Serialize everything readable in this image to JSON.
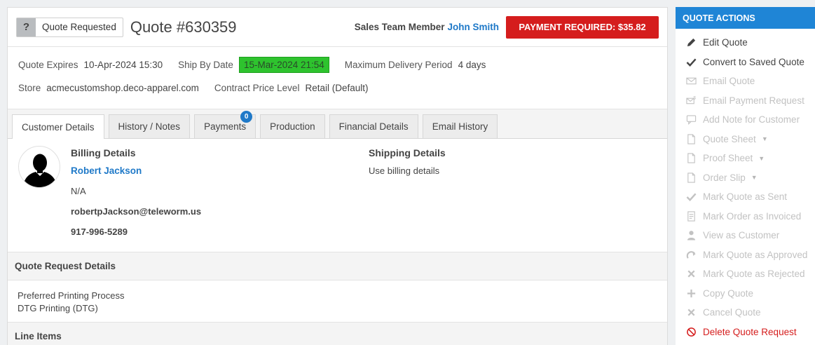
{
  "header": {
    "status_icon": "?",
    "status_label": "Quote Requested",
    "quote_title": "Quote #630359",
    "sales_label": "Sales Team Member",
    "sales_name": "John Smith",
    "payment_button": "PAYMENT REQUIRED: $35.82",
    "payment_color": "#d51d1d"
  },
  "meta": {
    "quote_expires_label": "Quote Expires",
    "quote_expires_value": "10-Apr-2024 15:30",
    "ship_by_label": "Ship By Date",
    "ship_by_value": "15-Mar-2024 21:54",
    "max_delivery_label": "Maximum Delivery Period",
    "max_delivery_value": "4 days",
    "store_label": "Store",
    "store_value": "acmecustomshop.deco-apparel.com",
    "contract_label": "Contract Price Level",
    "contract_value": "Retail (Default)"
  },
  "tabs": [
    {
      "label": "Customer Details",
      "active": true
    },
    {
      "label": "History / Notes"
    },
    {
      "label": "Payments",
      "badge": "0"
    },
    {
      "label": "Production"
    },
    {
      "label": "Financial Details"
    },
    {
      "label": "Email History"
    }
  ],
  "customer": {
    "billing_title": "Billing Details",
    "billing_name": "Robert Jackson",
    "billing_company": "N/A",
    "billing_email": "robertpJackson@teleworm.us",
    "billing_phone": "917-996-5289",
    "shipping_title": "Shipping Details",
    "shipping_text": "Use billing details"
  },
  "quote_request": {
    "title": "Quote Request Details",
    "process_label": "Preferred Printing Process",
    "process_value": "DTG Printing (DTG)"
  },
  "line_items": {
    "title": "Line Items"
  },
  "sidebar": {
    "title": "QUOTE ACTIONS",
    "accent": "#1f85d6",
    "actions": [
      {
        "label": "Edit Quote",
        "icon": "pencil-icon",
        "state": "enabled"
      },
      {
        "label": "Convert to Saved Quote",
        "icon": "check-icon",
        "state": "enabled"
      },
      {
        "label": "Email Quote",
        "icon": "envelope-icon",
        "state": "disabled"
      },
      {
        "label": "Email Payment Request",
        "icon": "envelope-dollar-icon",
        "state": "disabled"
      },
      {
        "label": "Add Note for Customer",
        "icon": "comment-icon",
        "state": "disabled"
      },
      {
        "label": "Quote Sheet",
        "icon": "file-icon",
        "state": "disabled",
        "dropdown": true
      },
      {
        "label": "Proof Sheet",
        "icon": "file-icon",
        "state": "disabled",
        "dropdown": true
      },
      {
        "label": "Order Slip",
        "icon": "file-icon",
        "state": "disabled",
        "dropdown": true
      },
      {
        "label": "Mark Quote as Sent",
        "icon": "check-icon",
        "state": "disabled"
      },
      {
        "label": "Mark Order as Invoiced",
        "icon": "invoice-icon",
        "state": "disabled"
      },
      {
        "label": "View as Customer",
        "icon": "user-icon",
        "state": "disabled"
      },
      {
        "label": "Mark Quote as Approved",
        "icon": "redo-icon",
        "state": "disabled"
      },
      {
        "label": "Mark Quote as Rejected",
        "icon": "times-icon",
        "state": "disabled"
      },
      {
        "label": "Copy Quote",
        "icon": "plus-icon",
        "state": "disabled"
      },
      {
        "label": "Cancel Quote",
        "icon": "times-icon",
        "state": "disabled"
      },
      {
        "label": "Delete Quote Request",
        "icon": "ban-icon",
        "state": "danger"
      }
    ]
  }
}
